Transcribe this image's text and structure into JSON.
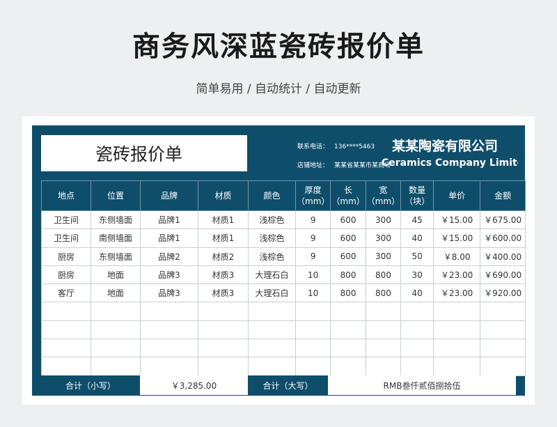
{
  "header": {
    "title": "商务风深蓝瓷砖报价单",
    "subtitle": "简单易用 / 自动统计 / 自动更新"
  },
  "sheet": {
    "doc_title": "瓷砖报价单",
    "contact": {
      "phone_label": "联系电话：",
      "phone": "136****5463",
      "address_label": "店铺地址：",
      "address": "某某省某某市某商场"
    },
    "company_cn": "某某陶瓷有限公司",
    "company_en": "Ceramics Company Limited",
    "columns": [
      "地点",
      "位置",
      "品牌",
      "材质",
      "颜色",
      "厚度（mm）",
      "长（mm）",
      "宽（mm）",
      "数量（块）",
      "单价",
      "金额"
    ],
    "rows": [
      [
        "卫生间",
        "东侧墙面",
        "品牌1",
        "材质1",
        "浅棕色",
        "9",
        "600",
        "300",
        "45",
        "￥15.00",
        "￥675.00"
      ],
      [
        "卫生间",
        "南侧墙面",
        "品牌1",
        "材质1",
        "浅棕色",
        "9",
        "600",
        "300",
        "40",
        "￥15.00",
        "￥600.00"
      ],
      [
        "厨房",
        "东侧墙面",
        "品牌2",
        "材质2",
        "浅棕色",
        "9",
        "600",
        "300",
        "50",
        "￥8.00",
        "￥400.00"
      ],
      [
        "厨房",
        "地面",
        "品牌3",
        "材质3",
        "大理石白",
        "10",
        "800",
        "800",
        "30",
        "￥23.00",
        "￥690.00"
      ],
      [
        "客厅",
        "地面",
        "品牌3",
        "材质3",
        "大理石白",
        "10",
        "800",
        "800",
        "40",
        "￥23.00",
        "￥920.00"
      ],
      [
        "",
        "",
        "",
        "",
        "",
        "",
        "",
        "",
        "",
        "",
        ""
      ],
      [
        "",
        "",
        "",
        "",
        "",
        "",
        "",
        "",
        "",
        "",
        ""
      ],
      [
        "",
        "",
        "",
        "",
        "",
        "",
        "",
        "",
        "",
        "",
        ""
      ],
      [
        "",
        "",
        "",
        "",
        "",
        "",
        "",
        "",
        "",
        "",
        ""
      ]
    ],
    "total_small_label": "合计（小写）",
    "total_small_value": "￥3,285.00",
    "total_big_label": "合计（大写）",
    "total_big_value": "RMB叁仟贰佰捌拾伍"
  },
  "colors": {
    "primary": "#0f4e6b",
    "background": "#eeeff1"
  }
}
